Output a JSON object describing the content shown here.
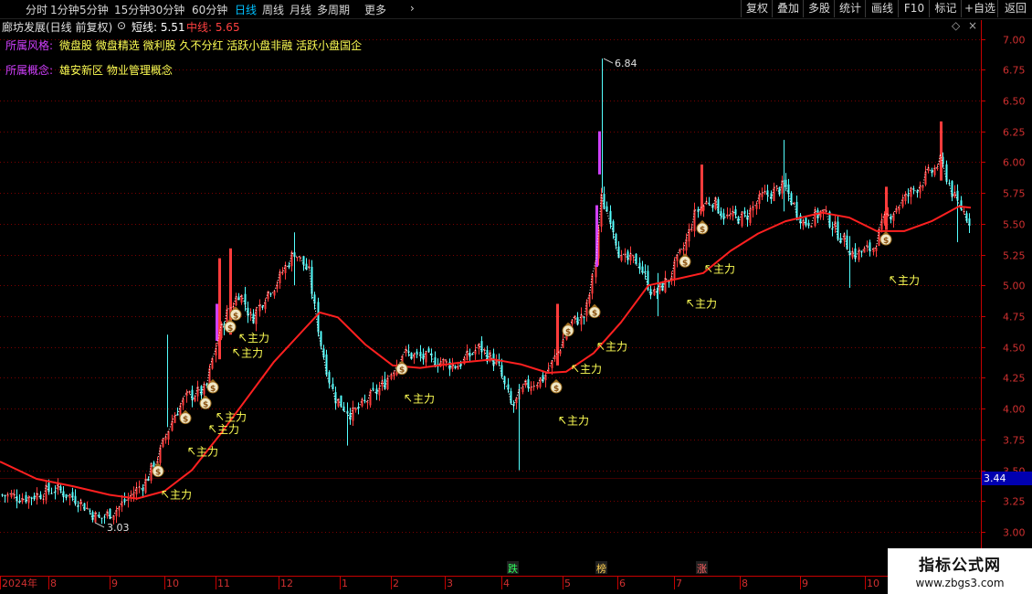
{
  "toolbar": {
    "periods": [
      "分时",
      "1分钟",
      "5分钟",
      "15分钟",
      "30分钟",
      "60分钟",
      "日线",
      "周线",
      "月线",
      "多周期",
      "更多"
    ],
    "active_period": "日线",
    "more_arrow": "›",
    "right_buttons": [
      "复权",
      "叠加",
      "多股",
      "统计",
      "画线",
      "F10",
      "+自选",
      "返回"
    ],
    "biaoji": "标记"
  },
  "info": {
    "title": "廊坊发展(日线 前复权)",
    "short_label": "短线: 5.51",
    "mid_label": "中线: 5.65",
    "style_label": "所属风格:",
    "style_value": "微盘股 微盘精选 微利股 久不分红 活跃小盘非融 活跃小盘国企",
    "concept_label": "所属概念:",
    "concept_value": "雄安新区 物业管理概念"
  },
  "colors": {
    "up": "#ff3c3c",
    "down": "#54ffff",
    "midline": "#ff2020",
    "shortline": "#ffffff",
    "limit_up": "#d040ff",
    "grid": "#7a0000",
    "axis_red": "#c80000",
    "annot_yellow": "#ffff54",
    "price_tag_bg": "#0000b0"
  },
  "icons": {
    "money_bag": "money-bag-icon",
    "arrow": "up-left-arrow-icon"
  },
  "chart_data": {
    "type": "candlestick",
    "y_ticks": [
      "7.00",
      "6.75",
      "6.50",
      "6.25",
      "6.00",
      "5.75",
      "5.50",
      "5.25",
      "5.00",
      "4.75",
      "4.50",
      "4.25",
      "4.00",
      "3.75",
      "3.50",
      "3.25",
      "3.00"
    ],
    "ylim": [
      2.95,
      7.05
    ],
    "current_price_tag": "3.44",
    "x_ticks": [
      "2024年",
      "8",
      "9",
      "10",
      "11",
      "12",
      "1",
      "2",
      "3",
      "4",
      "5",
      "6",
      "7",
      "8",
      "9",
      "10"
    ],
    "max_label": "6.84",
    "min_label": "3.03",
    "bottom_markers": [
      "跌",
      "榜",
      "涨"
    ],
    "zhuli_label": "主力",
    "mid_line": [
      {
        "x": 0,
        "p": 3.57
      },
      {
        "x": 40,
        "p": 3.43
      },
      {
        "x": 80,
        "p": 3.37
      },
      {
        "x": 120,
        "p": 3.3
      },
      {
        "x": 150,
        "p": 3.27
      },
      {
        "x": 180,
        "p": 3.33
      },
      {
        "x": 210,
        "p": 3.5
      },
      {
        "x": 240,
        "p": 3.78
      },
      {
        "x": 270,
        "p": 4.08
      },
      {
        "x": 300,
        "p": 4.38
      },
      {
        "x": 330,
        "p": 4.62
      },
      {
        "x": 350,
        "p": 4.78
      },
      {
        "x": 370,
        "p": 4.74
      },
      {
        "x": 400,
        "p": 4.52
      },
      {
        "x": 430,
        "p": 4.35
      },
      {
        "x": 460,
        "p": 4.33
      },
      {
        "x": 500,
        "p": 4.37
      },
      {
        "x": 540,
        "p": 4.4
      },
      {
        "x": 570,
        "p": 4.36
      },
      {
        "x": 600,
        "p": 4.29
      },
      {
        "x": 620,
        "p": 4.3
      },
      {
        "x": 650,
        "p": 4.45
      },
      {
        "x": 680,
        "p": 4.7
      },
      {
        "x": 710,
        "p": 5.0
      },
      {
        "x": 740,
        "p": 5.05
      },
      {
        "x": 770,
        "p": 5.1
      },
      {
        "x": 800,
        "p": 5.28
      },
      {
        "x": 830,
        "p": 5.42
      },
      {
        "x": 860,
        "p": 5.52
      },
      {
        "x": 900,
        "p": 5.59
      },
      {
        "x": 930,
        "p": 5.55
      },
      {
        "x": 960,
        "p": 5.44
      },
      {
        "x": 990,
        "p": 5.44
      },
      {
        "x": 1020,
        "p": 5.52
      },
      {
        "x": 1050,
        "p": 5.64
      },
      {
        "x": 1063,
        "p": 5.63
      }
    ],
    "close_anchors": [
      {
        "x": 0,
        "p": 3.3
      },
      {
        "x": 30,
        "p": 3.28
      },
      {
        "x": 60,
        "p": 3.35
      },
      {
        "x": 85,
        "p": 3.26
      },
      {
        "x": 108,
        "p": 3.1
      },
      {
        "x": 130,
        "p": 3.2
      },
      {
        "x": 160,
        "p": 3.42
      },
      {
        "x": 175,
        "p": 3.65
      },
      {
        "x": 190,
        "p": 3.95
      },
      {
        "x": 205,
        "p": 4.1
      },
      {
        "x": 225,
        "p": 4.15
      },
      {
        "x": 237,
        "p": 4.55
      },
      {
        "x": 250,
        "p": 4.8
      },
      {
        "x": 262,
        "p": 4.95
      },
      {
        "x": 275,
        "p": 4.72
      },
      {
        "x": 290,
        "p": 4.92
      },
      {
        "x": 305,
        "p": 5.05
      },
      {
        "x": 322,
        "p": 5.28
      },
      {
        "x": 338,
        "p": 5.1
      },
      {
        "x": 350,
        "p": 4.55
      },
      {
        "x": 365,
        "p": 4.1
      },
      {
        "x": 385,
        "p": 3.95
      },
      {
        "x": 400,
        "p": 4.05
      },
      {
        "x": 420,
        "p": 4.2
      },
      {
        "x": 440,
        "p": 4.45
      },
      {
        "x": 470,
        "p": 4.4
      },
      {
        "x": 500,
        "p": 4.35
      },
      {
        "x": 525,
        "p": 4.5
      },
      {
        "x": 545,
        "p": 4.35
      },
      {
        "x": 560,
        "p": 4.0
      },
      {
        "x": 575,
        "p": 4.18
      },
      {
        "x": 595,
        "p": 4.25
      },
      {
        "x": 610,
        "p": 4.45
      },
      {
        "x": 625,
        "p": 4.7
      },
      {
        "x": 640,
        "p": 4.75
      },
      {
        "x": 650,
        "p": 5.1
      },
      {
        "x": 658,
        "p": 5.7
      },
      {
        "x": 668,
        "p": 5.55
      },
      {
        "x": 680,
        "p": 5.2
      },
      {
        "x": 698,
        "p": 5.2
      },
      {
        "x": 715,
        "p": 4.92
      },
      {
        "x": 732,
        "p": 5.05
      },
      {
        "x": 748,
        "p": 5.3
      },
      {
        "x": 762,
        "p": 5.6
      },
      {
        "x": 778,
        "p": 5.7
      },
      {
        "x": 795,
        "p": 5.55
      },
      {
        "x": 815,
        "p": 5.55
      },
      {
        "x": 835,
        "p": 5.72
      },
      {
        "x": 858,
        "p": 5.8
      },
      {
        "x": 880,
        "p": 5.5
      },
      {
        "x": 900,
        "p": 5.6
      },
      {
        "x": 920,
        "p": 5.4
      },
      {
        "x": 935,
        "p": 5.25
      },
      {
        "x": 955,
        "p": 5.3
      },
      {
        "x": 970,
        "p": 5.55
      },
      {
        "x": 990,
        "p": 5.7
      },
      {
        "x": 1010,
        "p": 5.85
      },
      {
        "x": 1030,
        "p": 6.0
      },
      {
        "x": 1045,
        "p": 5.7
      },
      {
        "x": 1063,
        "p": 5.51
      }
    ],
    "spikes": [
      {
        "x": 183,
        "high": 4.6,
        "low": 3.85,
        "kind": "down"
      },
      {
        "x": 240,
        "high": 5.22,
        "low": 4.4,
        "kind": "up"
      },
      {
        "x": 252,
        "high": 5.3,
        "low": 4.6,
        "kind": "up"
      },
      {
        "x": 237,
        "high": 4.85,
        "low": 4.55,
        "kind": "limit"
      },
      {
        "x": 322,
        "high": 5.43,
        "low": 5.0,
        "kind": "down"
      },
      {
        "x": 380,
        "high": 4.05,
        "low": 3.7,
        "kind": "down"
      },
      {
        "x": 568,
        "high": 4.2,
        "low": 3.5,
        "kind": "down"
      },
      {
        "x": 610,
        "high": 4.85,
        "low": 4.35,
        "kind": "up"
      },
      {
        "x": 653,
        "high": 5.65,
        "low": 5.15,
        "kind": "limit"
      },
      {
        "x": 656,
        "high": 6.25,
        "low": 5.9,
        "kind": "limit"
      },
      {
        "x": 659,
        "high": 6.84,
        "low": 5.75,
        "kind": "down"
      },
      {
        "x": 720,
        "high": 5.1,
        "low": 4.75,
        "kind": "down"
      },
      {
        "x": 768,
        "high": 5.98,
        "low": 5.6,
        "kind": "up"
      },
      {
        "x": 858,
        "high": 6.18,
        "low": 5.6,
        "kind": "down"
      },
      {
        "x": 930,
        "high": 5.4,
        "low": 4.98,
        "kind": "down"
      },
      {
        "x": 970,
        "high": 5.8,
        "low": 5.45,
        "kind": "up"
      },
      {
        "x": 1030,
        "high": 6.33,
        "low": 5.85,
        "kind": "up"
      },
      {
        "x": 1048,
        "high": 5.7,
        "low": 5.35,
        "kind": "down"
      }
    ],
    "money_bags": [
      {
        "x": 173,
        "p": 3.5
      },
      {
        "x": 203,
        "p": 3.93
      },
      {
        "x": 225,
        "p": 4.05
      },
      {
        "x": 233,
        "p": 4.18
      },
      {
        "x": 252,
        "p": 4.67
      },
      {
        "x": 258,
        "p": 4.77
      },
      {
        "x": 440,
        "p": 4.33
      },
      {
        "x": 609,
        "p": 4.18
      },
      {
        "x": 622,
        "p": 4.64
      },
      {
        "x": 651,
        "p": 4.79
      },
      {
        "x": 750,
        "p": 5.2
      },
      {
        "x": 769,
        "p": 5.47
      },
      {
        "x": 970,
        "p": 5.38
      }
    ],
    "zhuli_marks": [
      {
        "x": 178,
        "p": 3.3
      },
      {
        "x": 207,
        "p": 3.65
      },
      {
        "x": 230,
        "p": 3.83
      },
      {
        "x": 238,
        "p": 3.93
      },
      {
        "x": 256,
        "p": 4.45
      },
      {
        "x": 263,
        "p": 4.57
      },
      {
        "x": 444,
        "p": 4.08
      },
      {
        "x": 613,
        "p": 3.9
      },
      {
        "x": 627,
        "p": 4.32
      },
      {
        "x": 655,
        "p": 4.5
      },
      {
        "x": 753,
        "p": 4.85
      },
      {
        "x": 773,
        "p": 5.13
      },
      {
        "x": 975,
        "p": 5.04
      }
    ]
  }
}
